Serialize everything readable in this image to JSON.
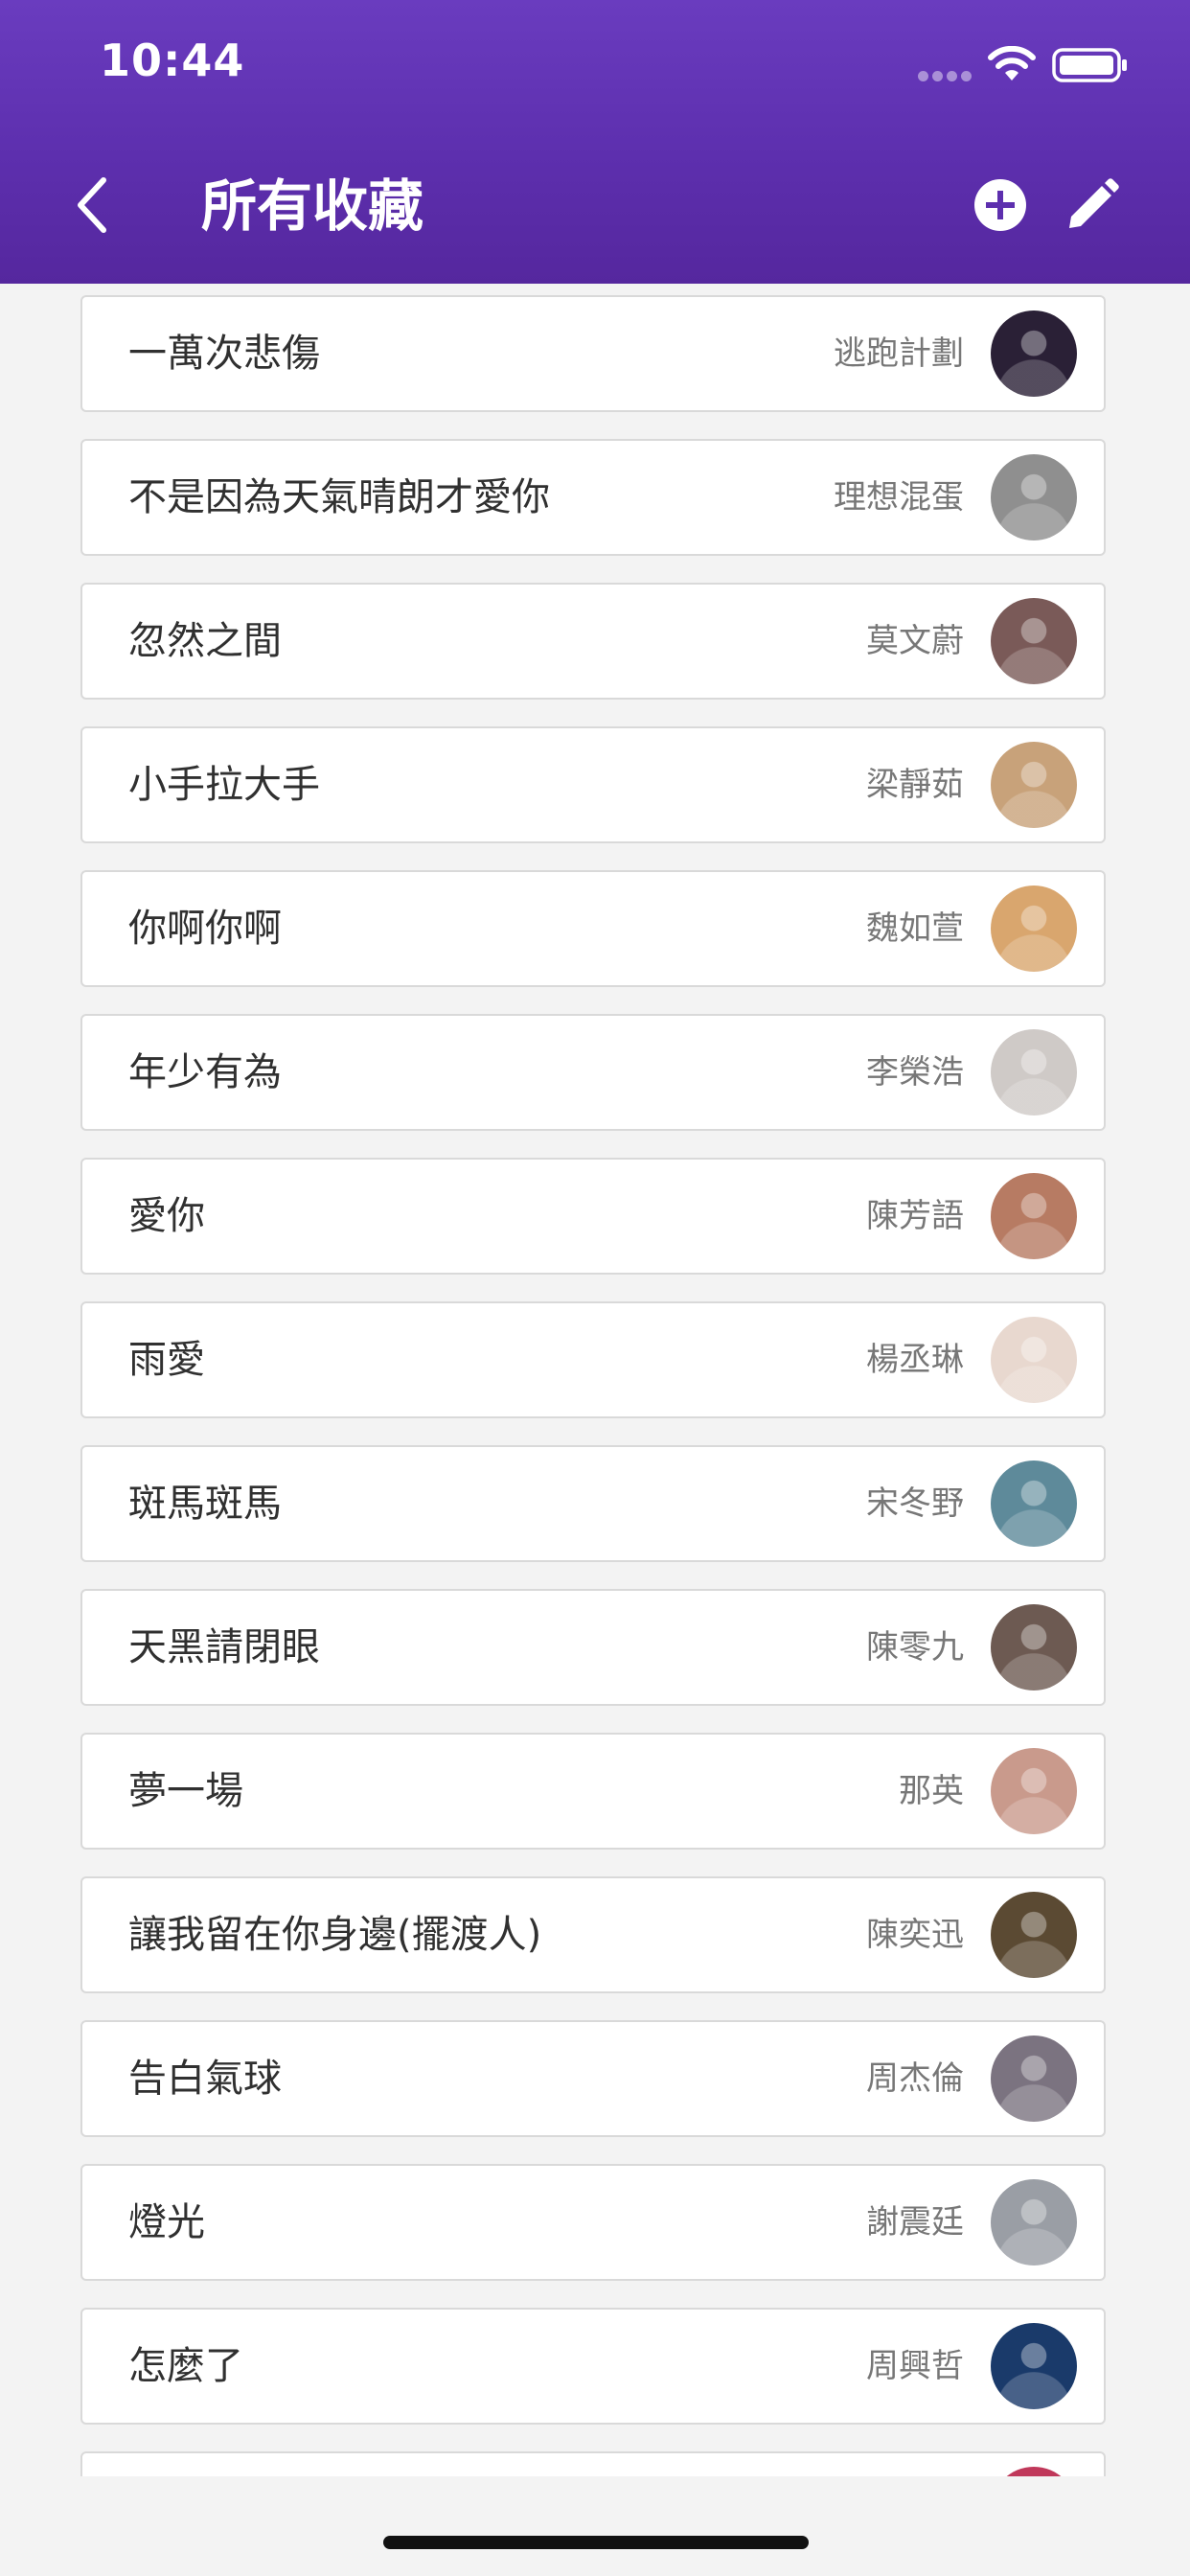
{
  "status_bar": {
    "time": "10:44"
  },
  "nav_bar": {
    "title": "所有收藏",
    "back_icon": "chevron-left-icon",
    "add_icon": "plus-circle-icon",
    "edit_icon": "pencil-icon"
  },
  "colors": {
    "header_top": "#6a3cbf",
    "header_bottom": "#55279e",
    "background": "#f3f3f3"
  },
  "favorites": [
    {
      "song": "一萬次悲傷",
      "artist": "逃跑計劃",
      "avatar_color": "#2a2036"
    },
    {
      "song": "不是因為天氣晴朗才愛你",
      "artist": "理想混蛋",
      "avatar_color": "#8f8f8f"
    },
    {
      "song": "忽然之間",
      "artist": "莫文蔚",
      "avatar_color": "#7a5a58"
    },
    {
      "song": "小手拉大手",
      "artist": "梁靜茹",
      "avatar_color": "#c8a27a"
    },
    {
      "song": "你啊你啊",
      "artist": "魏如萱",
      "avatar_color": "#d9a66e"
    },
    {
      "song": "年少有為",
      "artist": "李榮浩",
      "avatar_color": "#cfcac7"
    },
    {
      "song": "愛你",
      "artist": "陳芳語",
      "avatar_color": "#b77b63"
    },
    {
      "song": "雨愛",
      "artist": "楊丞琳",
      "avatar_color": "#e8d8cf"
    },
    {
      "song": "斑馬斑馬",
      "artist": "宋冬野",
      "avatar_color": "#5e8a9a"
    },
    {
      "song": "天黑請閉眼",
      "artist": "陳零九",
      "avatar_color": "#6d5a52"
    },
    {
      "song": "夢一場",
      "artist": "那英",
      "avatar_color": "#c99a8c"
    },
    {
      "song": "讓我留在你身邊(擺渡人)",
      "artist": "陳奕迅",
      "avatar_color": "#5b4a33"
    },
    {
      "song": "告白氣球",
      "artist": "周杰倫",
      "avatar_color": "#7b7380"
    },
    {
      "song": "燈光",
      "artist": "謝震廷",
      "avatar_color": "#9a9ea5"
    },
    {
      "song": "怎麼了",
      "artist": "周興哲",
      "avatar_color": "#1a3a6a"
    },
    {
      "song": "",
      "artist": "",
      "avatar_color": "#c0385a"
    }
  ]
}
